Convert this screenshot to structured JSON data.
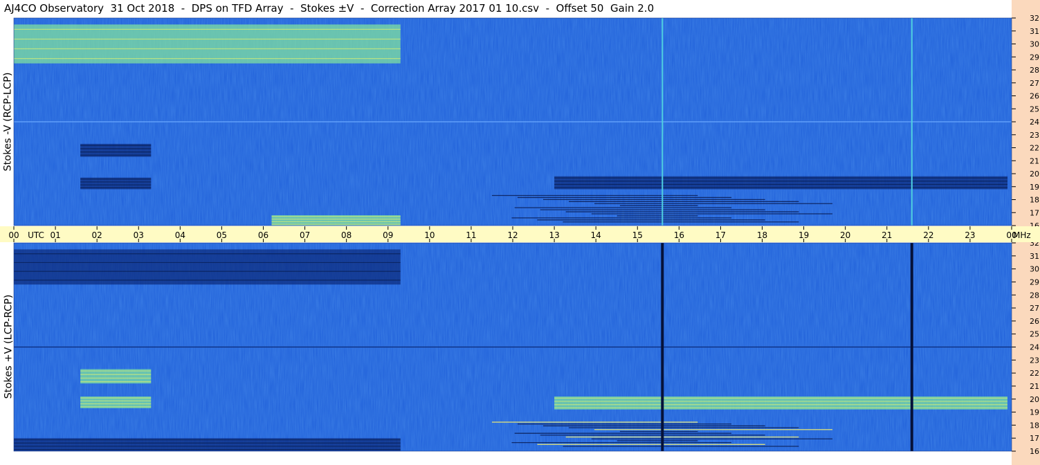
{
  "title": "AJ4CO Observatory  31 Oct 2018  -  DPS on TFD Array  -  Stokes ±V  -  Correction Array 2017 01 10.csv  -  Offset 50  Gain 2.0",
  "colors": {
    "background_blue": "#1f5fd9",
    "timebar": "#fffbc4",
    "freq_strip": "#fbd9bd"
  },
  "chart_data": [
    {
      "type": "heatmap",
      "panel": "top",
      "ylabel": "Stokes -V (RCP-LCP)",
      "yunit": "MHz",
      "ylim": [
        16,
        32
      ],
      "yticks": [
        "16",
        "17",
        "18",
        "19",
        "20",
        "21",
        "22",
        "23",
        "24",
        "25",
        "26",
        "27",
        "28",
        "29",
        "30",
        "31",
        "32"
      ],
      "xlim": [
        0,
        24
      ],
      "xlabel": "UTC",
      "xticks": [
        "00",
        "01",
        "02",
        "03",
        "04",
        "05",
        "06",
        "07",
        "08",
        "09",
        "10",
        "11",
        "12",
        "13",
        "14",
        "15",
        "16",
        "17",
        "18",
        "19",
        "20",
        "21",
        "22",
        "23",
        "00"
      ],
      "features": [
        {
          "kind": "enhanced",
          "t": [
            0,
            9.3
          ],
          "f": [
            28.5,
            31.5
          ]
        },
        {
          "kind": "enhanced",
          "t": [
            6.2,
            9.3
          ],
          "f": [
            16,
            16.8
          ]
        },
        {
          "kind": "depleted",
          "t": [
            1.6,
            3.3
          ],
          "f": [
            21.3,
            22.3
          ]
        },
        {
          "kind": "depleted",
          "t": [
            1.6,
            3.3
          ],
          "f": [
            18.8,
            19.7
          ]
        },
        {
          "kind": "depleted",
          "t": [
            13,
            23.9
          ],
          "f": [
            18.8,
            19.8
          ]
        },
        {
          "kind": "bursts",
          "t": [
            11.5,
            20.5
          ],
          "f": [
            16.2,
            18.4
          ]
        },
        {
          "kind": "line",
          "t": 15.6
        },
        {
          "kind": "line",
          "t": 21.6
        }
      ]
    },
    {
      "type": "heatmap",
      "panel": "bottom",
      "ylabel": "Stokes +V (LCP-RCP)",
      "yunit": "MHz",
      "ylim": [
        16,
        32
      ],
      "yticks": [
        "16",
        "17",
        "18",
        "19",
        "20",
        "21",
        "22",
        "23",
        "24",
        "25",
        "26",
        "27",
        "28",
        "29",
        "30",
        "31",
        "32"
      ],
      "xlim": [
        0,
        24
      ],
      "features": [
        {
          "kind": "depleted",
          "t": [
            0,
            9.3
          ],
          "f": [
            28.8,
            31.5
          ]
        },
        {
          "kind": "depleted",
          "t": [
            0,
            9.3
          ],
          "f": [
            16,
            17
          ]
        },
        {
          "kind": "enhanced",
          "t": [
            1.6,
            3.3
          ],
          "f": [
            21.2,
            22.3
          ]
        },
        {
          "kind": "enhanced",
          "t": [
            1.6,
            3.3
          ],
          "f": [
            19.3,
            20.2
          ]
        },
        {
          "kind": "enhanced",
          "t": [
            13,
            23.9
          ],
          "f": [
            19.2,
            20.2
          ]
        },
        {
          "kind": "bursts",
          "t": [
            11.5,
            20.5
          ],
          "f": [
            16.3,
            18.3
          ]
        },
        {
          "kind": "gap",
          "t": 15.6
        },
        {
          "kind": "gap",
          "t": 21.6
        }
      ]
    }
  ]
}
